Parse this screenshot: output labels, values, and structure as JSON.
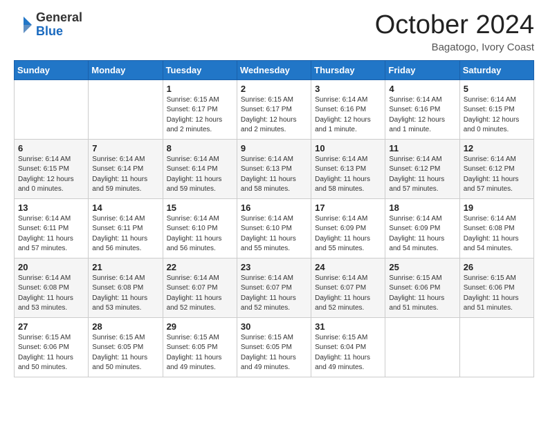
{
  "logo": {
    "general": "General",
    "blue": "Blue"
  },
  "title": "October 2024",
  "location": "Bagatogo, Ivory Coast",
  "weekdays": [
    "Sunday",
    "Monday",
    "Tuesday",
    "Wednesday",
    "Thursday",
    "Friday",
    "Saturday"
  ],
  "weeks": [
    [
      {
        "day": "",
        "sunrise": "",
        "sunset": "",
        "daylight": ""
      },
      {
        "day": "",
        "sunrise": "",
        "sunset": "",
        "daylight": ""
      },
      {
        "day": "1",
        "sunrise": "Sunrise: 6:15 AM",
        "sunset": "Sunset: 6:17 PM",
        "daylight": "Daylight: 12 hours and 2 minutes."
      },
      {
        "day": "2",
        "sunrise": "Sunrise: 6:15 AM",
        "sunset": "Sunset: 6:17 PM",
        "daylight": "Daylight: 12 hours and 2 minutes."
      },
      {
        "day": "3",
        "sunrise": "Sunrise: 6:14 AM",
        "sunset": "Sunset: 6:16 PM",
        "daylight": "Daylight: 12 hours and 1 minute."
      },
      {
        "day": "4",
        "sunrise": "Sunrise: 6:14 AM",
        "sunset": "Sunset: 6:16 PM",
        "daylight": "Daylight: 12 hours and 1 minute."
      },
      {
        "day": "5",
        "sunrise": "Sunrise: 6:14 AM",
        "sunset": "Sunset: 6:15 PM",
        "daylight": "Daylight: 12 hours and 0 minutes."
      }
    ],
    [
      {
        "day": "6",
        "sunrise": "Sunrise: 6:14 AM",
        "sunset": "Sunset: 6:15 PM",
        "daylight": "Daylight: 12 hours and 0 minutes."
      },
      {
        "day": "7",
        "sunrise": "Sunrise: 6:14 AM",
        "sunset": "Sunset: 6:14 PM",
        "daylight": "Daylight: 11 hours and 59 minutes."
      },
      {
        "day": "8",
        "sunrise": "Sunrise: 6:14 AM",
        "sunset": "Sunset: 6:14 PM",
        "daylight": "Daylight: 11 hours and 59 minutes."
      },
      {
        "day": "9",
        "sunrise": "Sunrise: 6:14 AM",
        "sunset": "Sunset: 6:13 PM",
        "daylight": "Daylight: 11 hours and 58 minutes."
      },
      {
        "day": "10",
        "sunrise": "Sunrise: 6:14 AM",
        "sunset": "Sunset: 6:13 PM",
        "daylight": "Daylight: 11 hours and 58 minutes."
      },
      {
        "day": "11",
        "sunrise": "Sunrise: 6:14 AM",
        "sunset": "Sunset: 6:12 PM",
        "daylight": "Daylight: 11 hours and 57 minutes."
      },
      {
        "day": "12",
        "sunrise": "Sunrise: 6:14 AM",
        "sunset": "Sunset: 6:12 PM",
        "daylight": "Daylight: 11 hours and 57 minutes."
      }
    ],
    [
      {
        "day": "13",
        "sunrise": "Sunrise: 6:14 AM",
        "sunset": "Sunset: 6:11 PM",
        "daylight": "Daylight: 11 hours and 57 minutes."
      },
      {
        "day": "14",
        "sunrise": "Sunrise: 6:14 AM",
        "sunset": "Sunset: 6:11 PM",
        "daylight": "Daylight: 11 hours and 56 minutes."
      },
      {
        "day": "15",
        "sunrise": "Sunrise: 6:14 AM",
        "sunset": "Sunset: 6:10 PM",
        "daylight": "Daylight: 11 hours and 56 minutes."
      },
      {
        "day": "16",
        "sunrise": "Sunrise: 6:14 AM",
        "sunset": "Sunset: 6:10 PM",
        "daylight": "Daylight: 11 hours and 55 minutes."
      },
      {
        "day": "17",
        "sunrise": "Sunrise: 6:14 AM",
        "sunset": "Sunset: 6:09 PM",
        "daylight": "Daylight: 11 hours and 55 minutes."
      },
      {
        "day": "18",
        "sunrise": "Sunrise: 6:14 AM",
        "sunset": "Sunset: 6:09 PM",
        "daylight": "Daylight: 11 hours and 54 minutes."
      },
      {
        "day": "19",
        "sunrise": "Sunrise: 6:14 AM",
        "sunset": "Sunset: 6:08 PM",
        "daylight": "Daylight: 11 hours and 54 minutes."
      }
    ],
    [
      {
        "day": "20",
        "sunrise": "Sunrise: 6:14 AM",
        "sunset": "Sunset: 6:08 PM",
        "daylight": "Daylight: 11 hours and 53 minutes."
      },
      {
        "day": "21",
        "sunrise": "Sunrise: 6:14 AM",
        "sunset": "Sunset: 6:08 PM",
        "daylight": "Daylight: 11 hours and 53 minutes."
      },
      {
        "day": "22",
        "sunrise": "Sunrise: 6:14 AM",
        "sunset": "Sunset: 6:07 PM",
        "daylight": "Daylight: 11 hours and 52 minutes."
      },
      {
        "day": "23",
        "sunrise": "Sunrise: 6:14 AM",
        "sunset": "Sunset: 6:07 PM",
        "daylight": "Daylight: 11 hours and 52 minutes."
      },
      {
        "day": "24",
        "sunrise": "Sunrise: 6:14 AM",
        "sunset": "Sunset: 6:07 PM",
        "daylight": "Daylight: 11 hours and 52 minutes."
      },
      {
        "day": "25",
        "sunrise": "Sunrise: 6:15 AM",
        "sunset": "Sunset: 6:06 PM",
        "daylight": "Daylight: 11 hours and 51 minutes."
      },
      {
        "day": "26",
        "sunrise": "Sunrise: 6:15 AM",
        "sunset": "Sunset: 6:06 PM",
        "daylight": "Daylight: 11 hours and 51 minutes."
      }
    ],
    [
      {
        "day": "27",
        "sunrise": "Sunrise: 6:15 AM",
        "sunset": "Sunset: 6:06 PM",
        "daylight": "Daylight: 11 hours and 50 minutes."
      },
      {
        "day": "28",
        "sunrise": "Sunrise: 6:15 AM",
        "sunset": "Sunset: 6:05 PM",
        "daylight": "Daylight: 11 hours and 50 minutes."
      },
      {
        "day": "29",
        "sunrise": "Sunrise: 6:15 AM",
        "sunset": "Sunset: 6:05 PM",
        "daylight": "Daylight: 11 hours and 49 minutes."
      },
      {
        "day": "30",
        "sunrise": "Sunrise: 6:15 AM",
        "sunset": "Sunset: 6:05 PM",
        "daylight": "Daylight: 11 hours and 49 minutes."
      },
      {
        "day": "31",
        "sunrise": "Sunrise: 6:15 AM",
        "sunset": "Sunset: 6:04 PM",
        "daylight": "Daylight: 11 hours and 49 minutes."
      },
      {
        "day": "",
        "sunrise": "",
        "sunset": "",
        "daylight": ""
      },
      {
        "day": "",
        "sunrise": "",
        "sunset": "",
        "daylight": ""
      }
    ]
  ]
}
